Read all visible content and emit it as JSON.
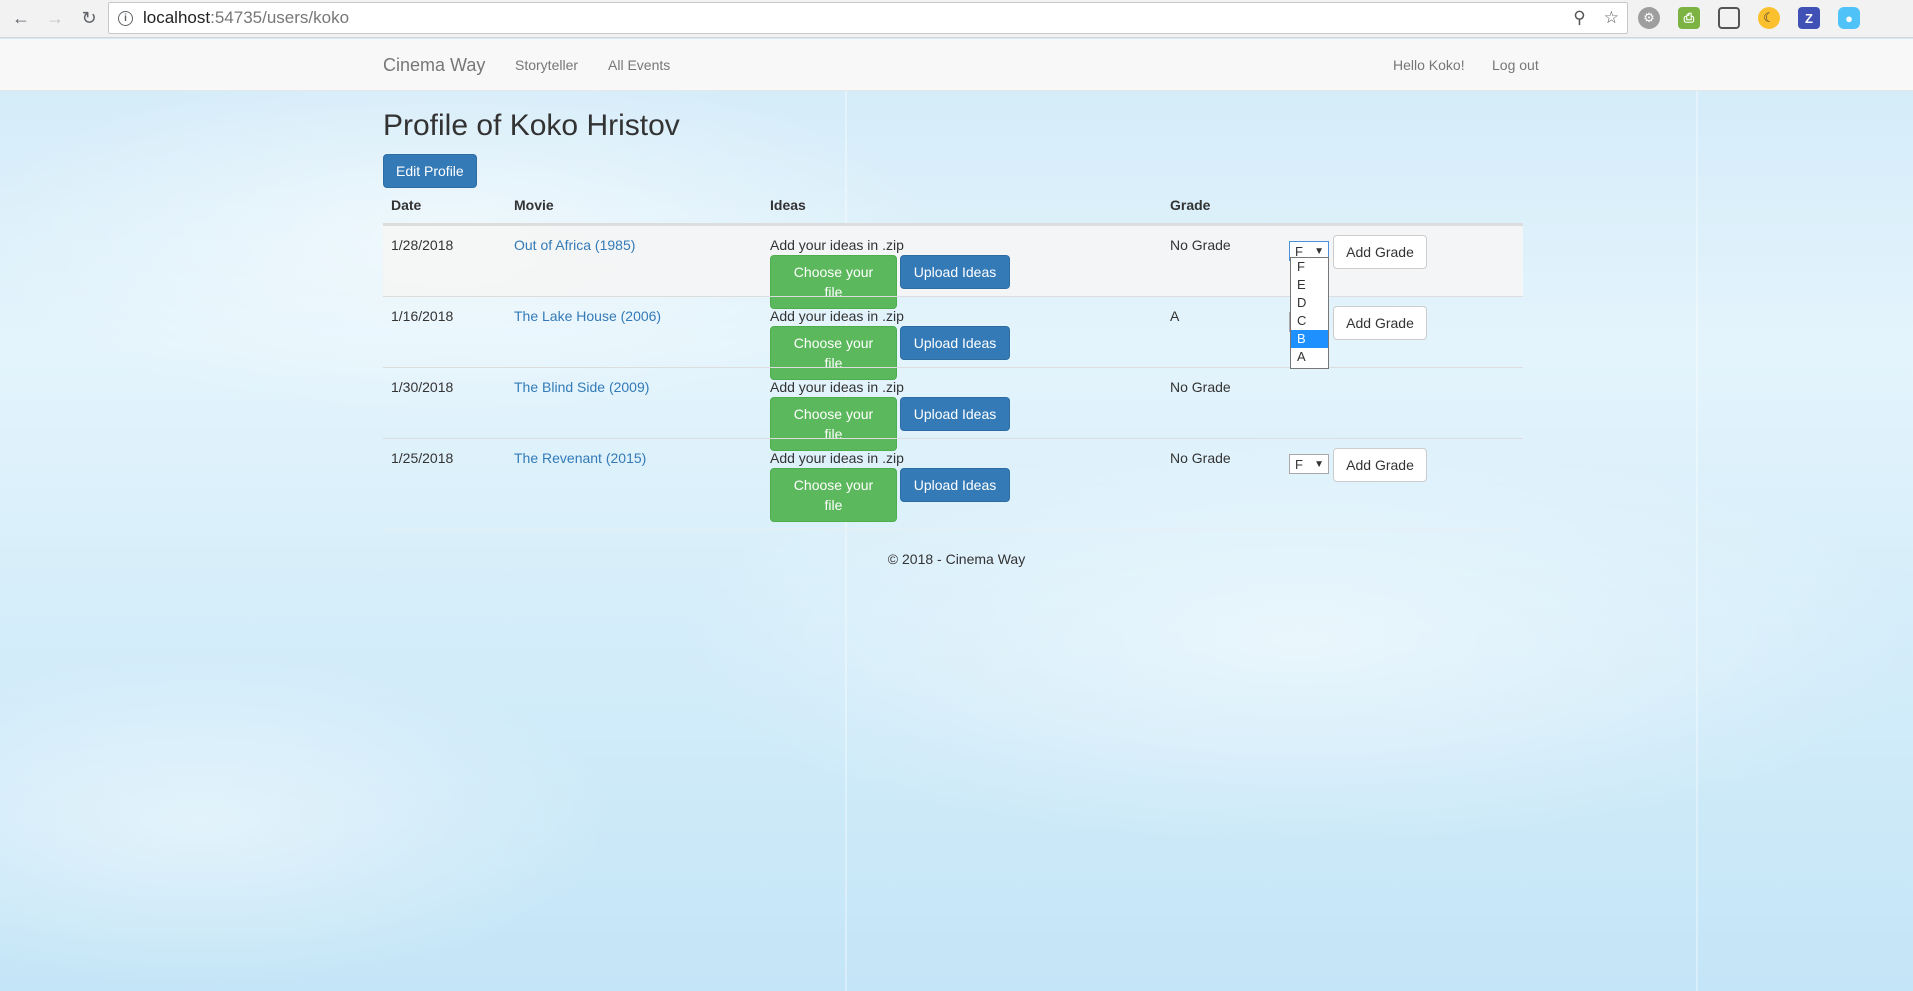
{
  "browser": {
    "url_host": "localhost",
    "url_rest": ":54735/users/koko"
  },
  "navbar": {
    "brand": "Cinema Way",
    "links": [
      "Storyteller",
      "All Events"
    ],
    "greeting": "Hello Koko!",
    "logout": "Log out"
  },
  "page": {
    "title": "Profile of Koko Hristov",
    "edit_button": "Edit Profile"
  },
  "table": {
    "headers": [
      "Date",
      "Movie",
      "Ideas",
      "Grade"
    ],
    "rows": [
      {
        "date": "1/28/2018",
        "movie": "Out of Africa (1985)",
        "ideas_text": "Add your ideas in .zip",
        "choose": "Choose your file",
        "upload": "Upload Ideas",
        "grade": "No Grade",
        "select_value": "F",
        "add_grade": "Add Grade"
      },
      {
        "date": "1/16/2018",
        "movie": "The Lake House (2006)",
        "ideas_text": "Add your ideas in .zip",
        "choose": "Choose your file",
        "upload": "Upload Ideas",
        "grade": "A",
        "select_value": "",
        "add_grade": "Add Grade"
      },
      {
        "date": "1/30/2018",
        "movie": "The Blind Side (2009)",
        "ideas_text": "Add your ideas in .zip",
        "choose": "Choose your file",
        "upload": "Upload Ideas",
        "grade": "No Grade",
        "select_value": "",
        "add_grade": ""
      },
      {
        "date": "1/25/2018",
        "movie": "The Revenant (2015)",
        "ideas_text": "Add your ideas in .zip",
        "choose": "Choose your file",
        "upload": "Upload Ideas",
        "grade": "No Grade",
        "select_value": "F",
        "add_grade": "Add Grade"
      }
    ]
  },
  "grade_dropdown": {
    "options": [
      "F",
      "E",
      "D",
      "C",
      "B",
      "A"
    ],
    "highlighted": "B"
  },
  "footer": "© 2018 - Cinema Way",
  "colors": {
    "primary": "#337ab7",
    "success": "#5cb85c",
    "dropdown_highlight": "#1e90ff"
  }
}
